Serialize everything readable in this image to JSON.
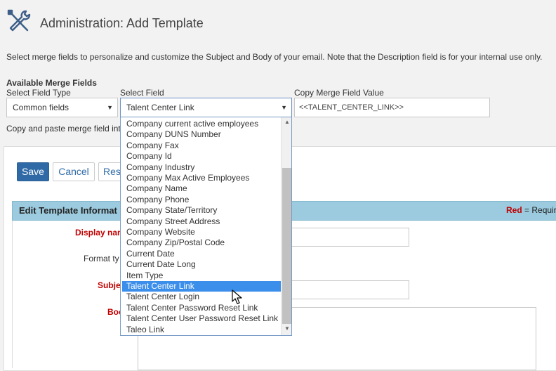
{
  "header": {
    "title": "Administration: Add Template",
    "icon": "tools-icon"
  },
  "intro_text": "Select merge fields to personalize and customize the Subject and Body of your email. Note that the Description field is for your internal use only.",
  "merge_fields": {
    "heading": "Available Merge Fields",
    "field_type_label": "Select Field Type",
    "field_type_value": "Common fields",
    "field_label": "Select Field",
    "field_value": "Talent Center Link",
    "copy_label": "Copy Merge Field Value",
    "copy_value": "<<TALENT_CENTER_LINK>>",
    "copy_note": "Copy and paste merge field int",
    "dropdown_options": [
      "Company current active employees",
      "Company DUNS Number",
      "Company Fax",
      "Company Id",
      "Company Industry",
      "Company Max Active Employees",
      "Company Name",
      "Company Phone",
      "Company State/Territory",
      "Company Street Address",
      "Company Website",
      "Company Zip/Postal Code",
      "Current Date",
      "Current Date Long",
      "Item Type",
      "Talent Center Link",
      "Talent Center Login",
      "Talent Center Password Reset Link",
      "Talent Center User Password Reset Link",
      "Taleo Link"
    ],
    "selected_index": 15
  },
  "actions": {
    "save": "Save",
    "cancel": "Cancel",
    "reset": "Res"
  },
  "form": {
    "section_title": "Edit Template Informat",
    "required_red": "Red",
    "required_rest": " = Require",
    "display_name_label": "Display nam",
    "format_label": "Format ty",
    "subject_label": "Subjec",
    "body_label": "Boo"
  },
  "colors": {
    "primary": "#2f6aa7",
    "section_bar": "#9ccbdf",
    "required": "#c00000",
    "selected_option": "#3b8eea"
  }
}
